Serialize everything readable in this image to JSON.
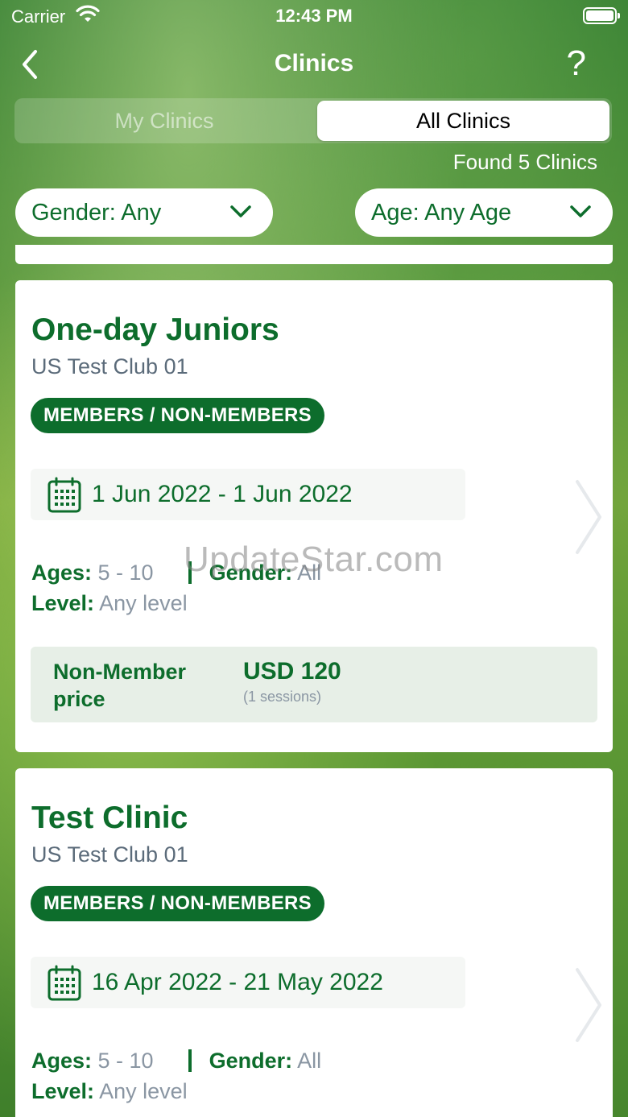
{
  "status_bar": {
    "carrier": "Carrier",
    "time": "12:43 PM"
  },
  "nav": {
    "title": "Clinics",
    "help": "?"
  },
  "tabs": [
    {
      "label": "My Clinics",
      "selected": false
    },
    {
      "label": "All Clinics",
      "selected": true
    }
  ],
  "found_text": "Found 5 Clinics",
  "filters": {
    "gender": "Gender: Any",
    "age": "Age: Any Age"
  },
  "clinics": [
    {
      "title": "One-day Juniors",
      "club": "US Test Club 01",
      "badge": "MEMBERS / NON-MEMBERS",
      "dates": "1 Jun 2022 - 1 Jun 2022",
      "ages_label": "Ages:",
      "ages_value": "5 - 10",
      "gender_label": "Gender:",
      "gender_value": "All",
      "level_label": "Level:",
      "level_value": "Any level",
      "price_label": "Non-Member price",
      "price_amount": "USD 120",
      "price_sessions": "(1 sessions)"
    },
    {
      "title": "Test Clinic",
      "club": "US Test Club 01",
      "badge": "MEMBERS / NON-MEMBERS",
      "dates": "16 Apr 2022 - 21 May 2022",
      "ages_label": "Ages:",
      "ages_value": "5 - 10",
      "gender_label": "Gender:",
      "gender_value": "All",
      "level_label": "Level:",
      "level_value": "Any level"
    }
  ],
  "watermark": "UpdateStar.com",
  "colors": {
    "brand_green": "#0d6d2c",
    "muted_text": "#8a96a3"
  }
}
